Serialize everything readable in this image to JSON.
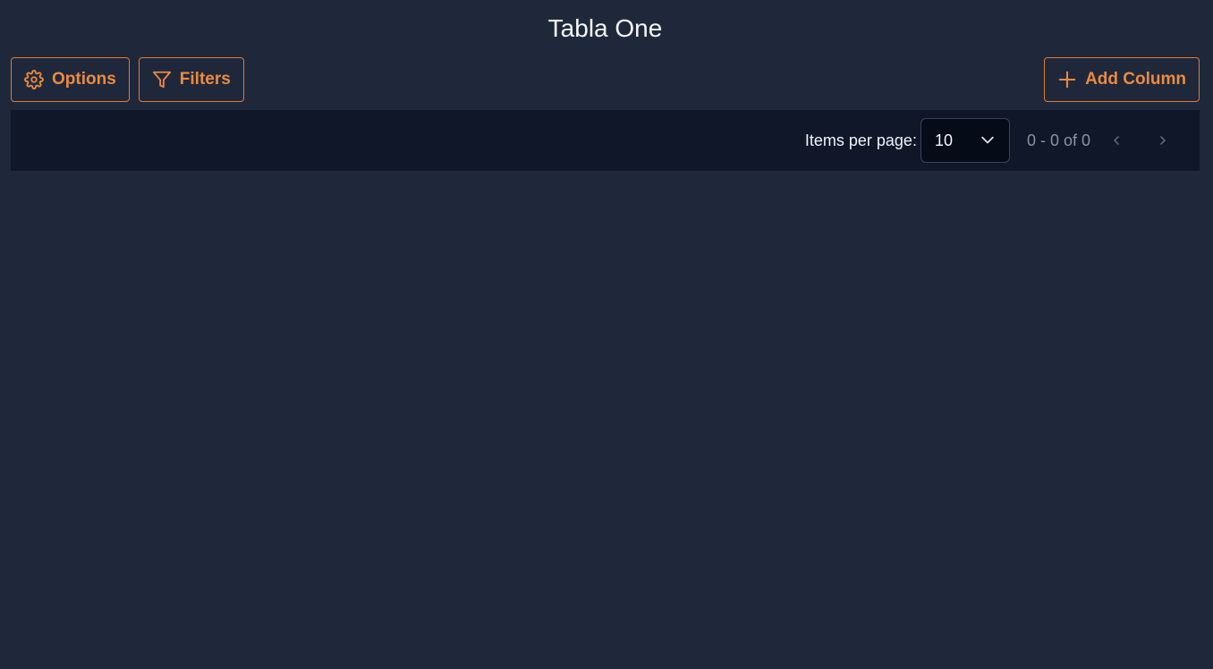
{
  "header": {
    "title": "Tabla One"
  },
  "toolbar": {
    "options_label": "Options",
    "options_icon": "gear-icon",
    "filters_label": "Filters",
    "filters_icon": "filter-icon",
    "add_column_label": "Add Column",
    "add_column_icon": "plus-icon"
  },
  "paginator": {
    "items_per_page_label": "Items per page:",
    "page_size": "10",
    "range_label": "0 - 0 of 0",
    "prev_icon": "chevron-left-icon",
    "next_icon": "chevron-right-icon"
  },
  "colors": {
    "background": "#1f283b",
    "accent": "#ec8a3f",
    "paginator_background": "#0f1729",
    "select_background": "#060b18",
    "muted_text": "#8a93a3"
  }
}
